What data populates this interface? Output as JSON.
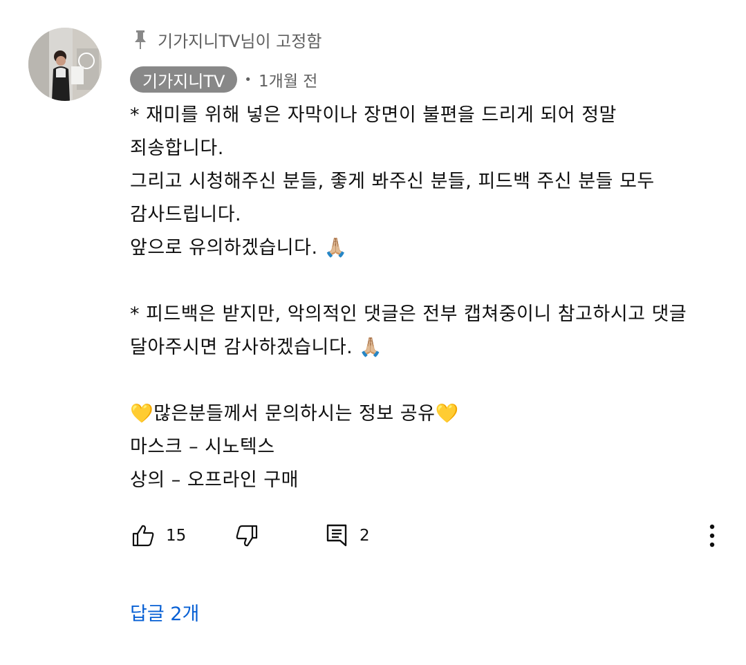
{
  "pinned": {
    "text": "기가지니TV님이 고정함",
    "icon": "pin-icon"
  },
  "comment": {
    "author": "기가지니TV",
    "separator": "•",
    "time": "1개월 전",
    "lines": [
      "* 재미를 위해 넣은 자막이나 장면이 불편을 드리게 되어 정말",
      "죄송합니다.",
      "그리고 시청해주신 분들, 좋게 봐주신 분들, 피드백 주신 분들 모두",
      "감사드립니다.",
      "앞으로 유의하겠습니다. 🙏🏼",
      "",
      "* 피드백은 받지만, 악의적인 댓글은 전부 캡쳐중이니 참고하시고 댓글",
      "달아주시면 감사하겠습니다. 🙏🏼",
      "",
      "💛많은분들께서 문의하시는 정보 공유💛",
      "마스크 – 시노텍스",
      "상의 – 오프라인 구매"
    ]
  },
  "actions": {
    "like_count": "15",
    "reply_count": "2"
  },
  "replies_link": "답글 2개",
  "colors": {
    "author_chip_bg": "#888888",
    "link": "#065fd4",
    "meta_text": "#606060"
  }
}
